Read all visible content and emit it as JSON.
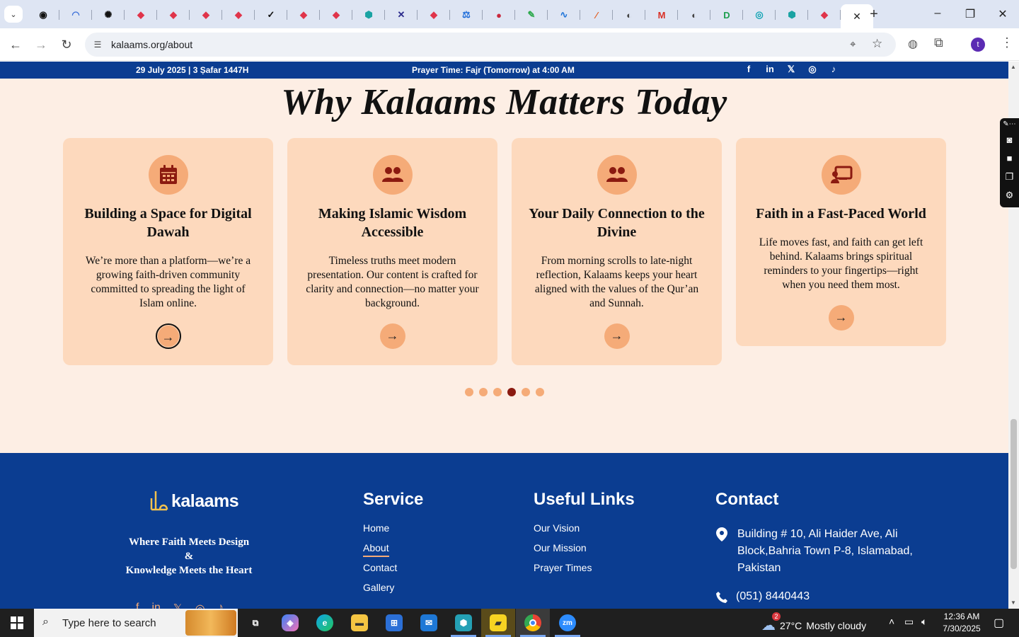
{
  "browser": {
    "tabs": [
      {
        "icon": "github-icon",
        "color": "#111111",
        "glyph": "◉"
      },
      {
        "icon": "wifi-tab-icon",
        "color": "#3b6fd8",
        "glyph": "◠"
      },
      {
        "icon": "openai-icon",
        "color": "#111111",
        "glyph": "✺"
      },
      {
        "icon": "diamond-red-icon",
        "color": "#e0344a",
        "glyph": "◆"
      },
      {
        "icon": "diamond-red-icon",
        "color": "#e0344a",
        "glyph": "◆"
      },
      {
        "icon": "diamond-red-icon",
        "color": "#e0344a",
        "glyph": "◆"
      },
      {
        "icon": "diamond-red-icon",
        "color": "#e0344a",
        "glyph": "◆"
      },
      {
        "icon": "checkmark-icon",
        "color": "#111111",
        "glyph": "✓"
      },
      {
        "icon": "diamond-red-icon",
        "color": "#e0344a",
        "glyph": "◆"
      },
      {
        "icon": "diamond-red-icon",
        "color": "#e0344a",
        "glyph": "◆"
      },
      {
        "icon": "hexagon-teal-icon",
        "color": "#1aa3a3",
        "glyph": "⬢"
      },
      {
        "icon": "x-logo-icon",
        "color": "#2b2b8c",
        "glyph": "✕"
      },
      {
        "icon": "diamond-red-icon",
        "color": "#e0344a",
        "glyph": "◆"
      },
      {
        "icon": "scales-icon",
        "color": "#1a6ad9",
        "glyph": "⚖"
      },
      {
        "icon": "blob-red-icon",
        "color": "#c9283d",
        "glyph": "●"
      },
      {
        "icon": "pen-green-icon",
        "color": "#2aa84a",
        "glyph": "✎"
      },
      {
        "icon": "pulse-blue-icon",
        "color": "#1b72d8",
        "glyph": "∿"
      },
      {
        "icon": "slash-orange-icon",
        "color": "#e25b1d",
        "glyph": "⁄"
      },
      {
        "icon": "globe-dark-icon",
        "color": "#444444",
        "glyph": "◐"
      },
      {
        "icon": "gmail-icon",
        "color": "#d93025",
        "glyph": "M"
      },
      {
        "icon": "globe-dark-icon",
        "color": "#444444",
        "glyph": "◐"
      },
      {
        "icon": "d-green-icon",
        "color": "#1d9e4e",
        "glyph": "D"
      },
      {
        "icon": "search-teal-icon",
        "color": "#10a3b3",
        "glyph": "◎"
      },
      {
        "icon": "hexagon-teal-icon",
        "color": "#1aa3a3",
        "glyph": "⬢"
      },
      {
        "icon": "diamond-red-icon",
        "color": "#e0344a",
        "glyph": "◆"
      }
    ],
    "url": "kalaams.org/about",
    "profile_initial": "t"
  },
  "topstrip": {
    "date": "29 July 2025 | 3 Ṣafar 1447H",
    "prayer_prefix": "Prayer Time: ",
    "prayer_name": "Fajr (Tomorrow)",
    "prayer_suffix": " at 4:00 AM",
    "socials": [
      "f",
      "in",
      "𝕏",
      "◎",
      "♪"
    ]
  },
  "section": {
    "title": "Why Kalaams Matters Today"
  },
  "cards": [
    {
      "icon": "calendar-icon",
      "title": "Building a Space for Digital Dawah",
      "body": "We’re more than a platform—we’re a growing faith-driven community committed to spreading the light of Islam online.",
      "arrow": "→"
    },
    {
      "icon": "users-icon",
      "title": "Making Islamic Wisdom Accessible",
      "body": "Timeless truths meet modern presentation. Our content is crafted for clarity and connection—no matter your background.",
      "arrow": "→"
    },
    {
      "icon": "users-icon",
      "title": "Your Daily Connection to the Divine",
      "body": "From morning scrolls to late-night reflection, Kalaams keeps your heart aligned with the values of the Qur’an and Sunnah.",
      "arrow": "→"
    },
    {
      "icon": "presentation-icon",
      "title": "Faith in a Fast-Paced World",
      "body": "Life moves fast, and faith can get left behind. Kalaams brings spiritual reminders to your fingertips—right when you need them most.",
      "arrow": "→"
    }
  ],
  "carousel": {
    "dot_count": 6,
    "active_index": 3
  },
  "footer": {
    "logo_text": "kalaams",
    "tagline_1": "Where Faith Meets Design",
    "tagline_2": "&",
    "tagline_3": "Knowledge Meets the Heart",
    "service_heading": "Service",
    "service_links": [
      "Home",
      "About",
      "Contact",
      "Gallery"
    ],
    "useful_heading": "Useful Links",
    "useful_links": [
      "Our Vision",
      "Our Mission",
      "Prayer Times"
    ],
    "contact_heading": "Contact",
    "address": "Building # 10, Ali Haider Ave, Ali Block,Bahria Town P-8, Islamabad, Pakistan",
    "phone": "(051) 8440443"
  },
  "taskbar": {
    "search_placeholder": "Type here to search",
    "weather_badge": "2",
    "temperature": "27°C",
    "weather_text": "Mostly cloudy",
    "time": "12:36 AM",
    "date": "7/30/2025"
  },
  "colors": {
    "brand_blue": "#0b3d91",
    "card_bg": "#fdd9bd",
    "accent_peach": "#f5ab78",
    "icon_maroon": "#8b1a10",
    "page_bg": "#fdeee4"
  }
}
